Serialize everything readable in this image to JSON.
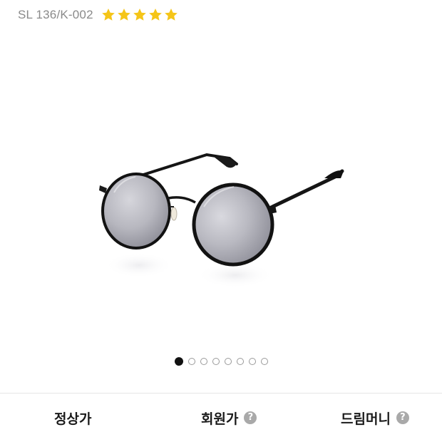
{
  "product": {
    "model_code": "SL 136/K-002",
    "rating_stars": 5,
    "rating_color": "#f5c518"
  },
  "gallery": {
    "total_images": 8,
    "active_index": 0,
    "image_name": "sunglasses-product-photo"
  },
  "prices": {
    "regular_label": "정상가",
    "member_label": "회원가",
    "dreammoney_label": "드림머니",
    "help_glyph": "?"
  },
  "colors": {
    "star": "#f5c518",
    "active_dot": "#111111",
    "inactive_dot_border": "#9a9a9a",
    "help_icon_bg": "#a9a9a9"
  }
}
